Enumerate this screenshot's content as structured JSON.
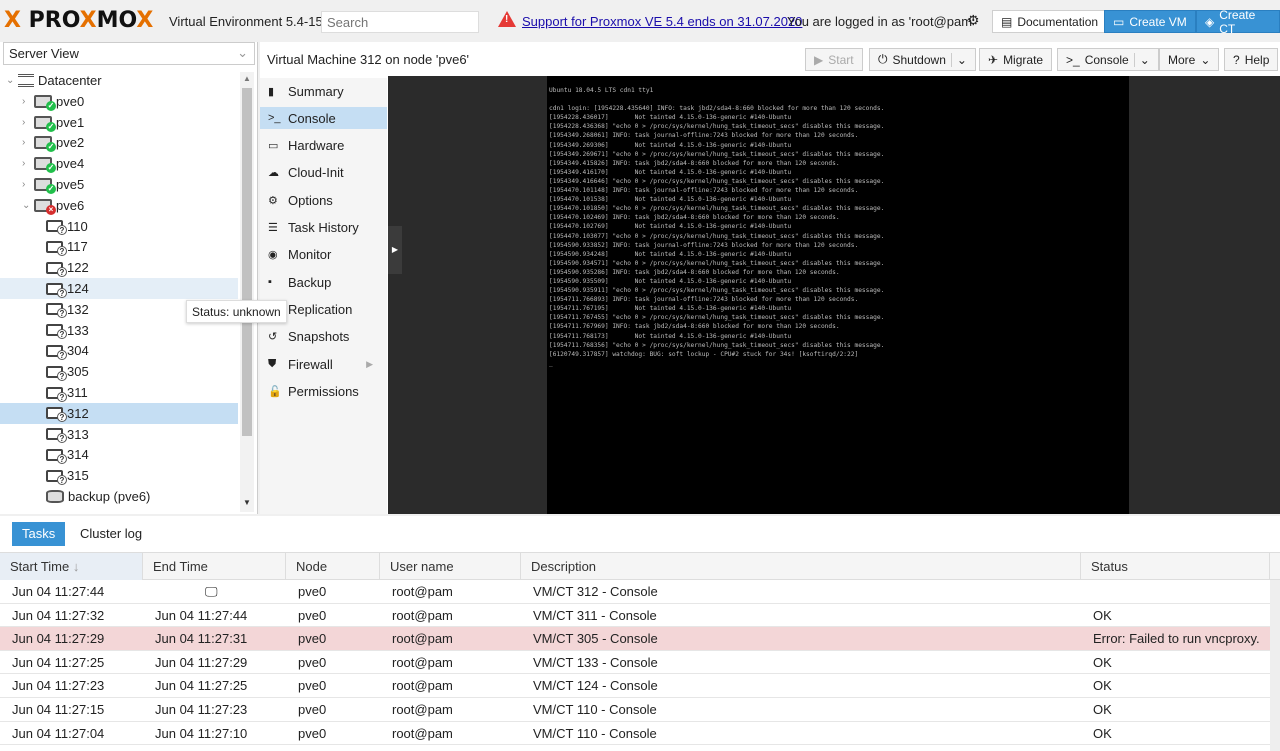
{
  "header": {
    "logo": "PROXMOX",
    "version": "Virtual Environment 5.4-15",
    "search_placeholder": "Search",
    "support_link": "Support for Proxmox VE 5.4 ends on 31.07.2020",
    "logged_in": "You are logged in as 'root@pam'",
    "buttons": [
      "Documentation",
      "Create VM",
      "Create CT"
    ]
  },
  "left": {
    "view": "Server View",
    "tree": [
      {
        "label": "Datacenter",
        "type": "datacenter",
        "level": 0
      },
      {
        "label": "pve0",
        "type": "node",
        "status": "online",
        "level": 1
      },
      {
        "label": "pve1",
        "type": "node",
        "status": "online",
        "level": 1
      },
      {
        "label": "pve2",
        "type": "node",
        "status": "online",
        "level": 1
      },
      {
        "label": "pve4",
        "type": "node",
        "status": "online",
        "level": 1
      },
      {
        "label": "pve5",
        "type": "node",
        "status": "online",
        "level": 1
      },
      {
        "label": "pve6",
        "type": "node",
        "status": "offline",
        "level": 1
      },
      {
        "label": "110",
        "type": "vm",
        "level": 2
      },
      {
        "label": "117",
        "type": "vm",
        "level": 2
      },
      {
        "label": "122",
        "type": "vm",
        "level": 2
      },
      {
        "label": "124",
        "type": "vm",
        "level": 2,
        "hover": true
      },
      {
        "label": "132",
        "type": "vm",
        "level": 2
      },
      {
        "label": "133",
        "type": "vm",
        "level": 2
      },
      {
        "label": "304",
        "type": "vm",
        "level": 2
      },
      {
        "label": "305",
        "type": "vm",
        "level": 2
      },
      {
        "label": "311",
        "type": "vm",
        "level": 2
      },
      {
        "label": "312",
        "type": "vm",
        "level": 2,
        "selected": true
      },
      {
        "label": "313",
        "type": "vm",
        "level": 2
      },
      {
        "label": "314",
        "type": "vm",
        "level": 2
      },
      {
        "label": "315",
        "type": "vm",
        "level": 2
      },
      {
        "label": "backup (pve6)",
        "type": "storage",
        "level": 2
      }
    ],
    "tooltip": "Status: unknown"
  },
  "main": {
    "title": "Virtual Machine 312 on node 'pve6'",
    "toolbar": {
      "start": "Start",
      "shutdown": "Shutdown",
      "migrate": "Migrate",
      "console": "Console",
      "more": "More",
      "help": "Help"
    },
    "menu": [
      {
        "label": "Summary",
        "icon": "book"
      },
      {
        "label": "Console",
        "icon": "terminal",
        "selected": true
      },
      {
        "label": "Hardware",
        "icon": "desktop"
      },
      {
        "label": "Cloud-Init",
        "icon": "cloud"
      },
      {
        "label": "Options",
        "icon": "gear"
      },
      {
        "label": "Task History",
        "icon": "list"
      },
      {
        "label": "Monitor",
        "icon": "eye"
      },
      {
        "label": "Backup",
        "icon": "floppy"
      },
      {
        "label": "Replication",
        "icon": "retweet"
      },
      {
        "label": "Snapshots",
        "icon": "history"
      },
      {
        "label": "Firewall",
        "icon": "shield",
        "submenu": true
      },
      {
        "label": "Permissions",
        "icon": "unlock"
      }
    ],
    "console_text": "Ubuntu 18.04.5 LTS cdn1 tty1\n\ncdn1 login: [1954228.435640] INFO: task jbd2/sda4-8:660 blocked for more than 120 seconds.\n[1954228.436017]       Not tainted 4.15.0-136-generic #140-Ubuntu\n[1954228.436368] \"echo 0 > /proc/sys/kernel/hung_task_timeout_secs\" disables this message.\n[1954349.268061] INFO: task journal-offline:7243 blocked for more than 120 seconds.\n[1954349.269306]       Not tainted 4.15.0-136-generic #140-Ubuntu\n[1954349.269671] \"echo 0 > /proc/sys/kernel/hung_task_timeout_secs\" disables this message.\n[1954349.415826] INFO: task jbd2/sda4-8:660 blocked for more than 120 seconds.\n[1954349.416170]       Not tainted 4.15.0-136-generic #140-Ubuntu\n[1954349.416646] \"echo 0 > /proc/sys/kernel/hung_task_timeout_secs\" disables this message.\n[1954470.101148] INFO: task journal-offline:7243 blocked for more than 120 seconds.\n[1954470.101538]       Not tainted 4.15.0-136-generic #140-Ubuntu\n[1954470.101850] \"echo 0 > /proc/sys/kernel/hung_task_timeout_secs\" disables this message.\n[1954470.102469] INFO: task jbd2/sda4-8:660 blocked for more than 120 seconds.\n[1954470.102769]       Not tainted 4.15.0-136-generic #140-Ubuntu\n[1954470.103077] \"echo 0 > /proc/sys/kernel/hung_task_timeout_secs\" disables this message.\n[1954590.933852] INFO: task journal-offline:7243 blocked for more than 120 seconds.\n[1954590.934248]       Not tainted 4.15.0-136-generic #140-Ubuntu\n[1954590.934571] \"echo 0 > /proc/sys/kernel/hung_task_timeout_secs\" disables this message.\n[1954590.935286] INFO: task jbd2/sda4-8:660 blocked for more than 120 seconds.\n[1954590.935509]       Not tainted 4.15.0-136-generic #140-Ubuntu\n[1954590.935911] \"echo 0 > /proc/sys/kernel/hung_task_timeout_secs\" disables this message.\n[1954711.766893] INFO: task journal-offline:7243 blocked for more than 120 seconds.\n[1954711.767195]       Not tainted 4.15.0-136-generic #140-Ubuntu\n[1954711.767455] \"echo 0 > /proc/sys/kernel/hung_task_timeout_secs\" disables this message.\n[1954711.767969] INFO: task jbd2/sda4-8:660 blocked for more than 120 seconds.\n[1954711.768173]       Not tainted 4.15.0-136-generic #140-Ubuntu\n[1954711.768356] \"echo 0 > /proc/sys/kernel/hung_task_timeout_secs\" disables this message.\n[6120749.317857] watchdog: BUG: soft lockup - CPU#2 stuck for 34s! [ksoftirqd/2:22]\n_"
  },
  "bottom": {
    "tabs": [
      "Tasks",
      "Cluster log"
    ],
    "columns": [
      "Start Time",
      "End Time",
      "Node",
      "User name",
      "Description",
      "Status"
    ],
    "rows": [
      {
        "start": "Jun 04 11:27:44",
        "end": "",
        "running": true,
        "node": "pve0",
        "user": "root@pam",
        "desc": "VM/CT 312 - Console",
        "status": ""
      },
      {
        "start": "Jun 04 11:27:32",
        "end": "Jun 04 11:27:44",
        "node": "pve0",
        "user": "root@pam",
        "desc": "VM/CT 311 - Console",
        "status": "OK"
      },
      {
        "start": "Jun 04 11:27:29",
        "end": "Jun 04 11:27:31",
        "node": "pve0",
        "user": "root@pam",
        "desc": "VM/CT 305 - Console",
        "status": "Error: Failed to run vncproxy.",
        "error": true
      },
      {
        "start": "Jun 04 11:27:25",
        "end": "Jun 04 11:27:29",
        "node": "pve0",
        "user": "root@pam",
        "desc": "VM/CT 133 - Console",
        "status": "OK"
      },
      {
        "start": "Jun 04 11:27:23",
        "end": "Jun 04 11:27:25",
        "node": "pve0",
        "user": "root@pam",
        "desc": "VM/CT 124 - Console",
        "status": "OK"
      },
      {
        "start": "Jun 04 11:27:15",
        "end": "Jun 04 11:27:23",
        "node": "pve0",
        "user": "root@pam",
        "desc": "VM/CT 110 - Console",
        "status": "OK"
      },
      {
        "start": "Jun 04 11:27:04",
        "end": "Jun 04 11:27:10",
        "node": "pve0",
        "user": "root@pam",
        "desc": "VM/CT 110 - Console",
        "status": "OK"
      }
    ]
  },
  "colors": {
    "accent": "#3892d4",
    "selected": "#c5def3",
    "error_row": "#f3d6d7",
    "logo_orange": "#e57000",
    "ok_badge": "#21bf4b",
    "offline_badge": "#d62e2e"
  }
}
